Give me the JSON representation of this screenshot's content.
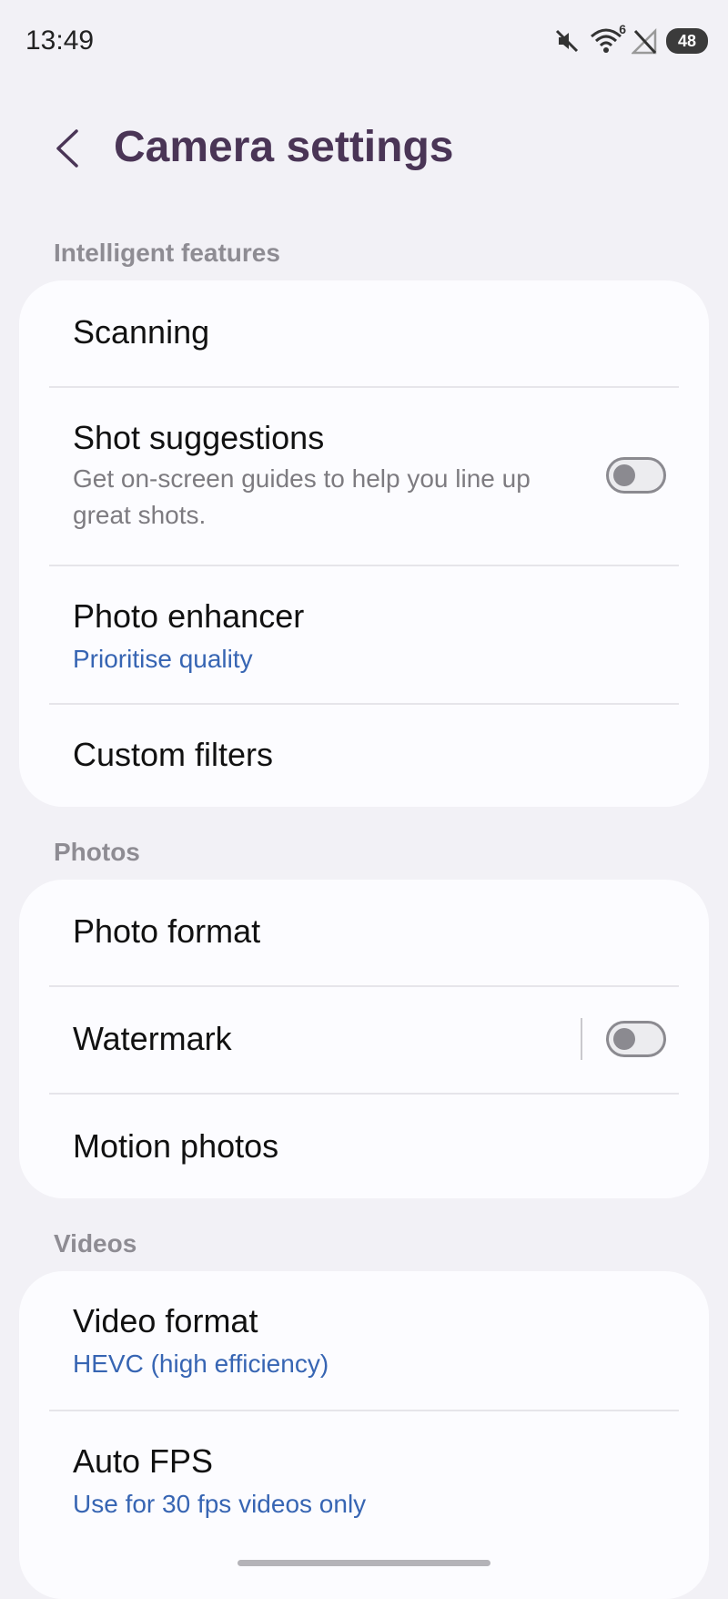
{
  "status_bar": {
    "time": "13:49",
    "icons": [
      "mute-icon",
      "wifi-icon",
      "no-signal-icon",
      "battery-icon"
    ],
    "wifi_badge": "6",
    "battery_level": "48"
  },
  "header": {
    "back_icon": "chevron-left-icon",
    "title": "Camera settings"
  },
  "sections": [
    {
      "label": "Intelligent features",
      "items": [
        {
          "title": "Scanning"
        },
        {
          "title": "Shot suggestions",
          "subtitle": "Get on-screen guides to help you line up great shots.",
          "toggle": false
        },
        {
          "title": "Photo enhancer",
          "subtitle": "Prioritise quality"
        },
        {
          "title": "Custom filters"
        }
      ]
    },
    {
      "label": "Photos",
      "items": [
        {
          "title": "Photo format"
        },
        {
          "title": "Watermark",
          "toggle": false
        },
        {
          "title": "Motion photos"
        }
      ]
    },
    {
      "label": "Videos",
      "items": [
        {
          "title": "Video format",
          "subtitle": "HEVC (high efficiency)"
        },
        {
          "title": "Auto FPS",
          "subtitle": "Use for 30 fps videos only"
        }
      ]
    }
  ],
  "colors": {
    "background": "#f2f1f6",
    "card": "#fcfcff",
    "title": "#4a3556",
    "accent": "#3765b3",
    "section_label": "#8e8c93"
  }
}
